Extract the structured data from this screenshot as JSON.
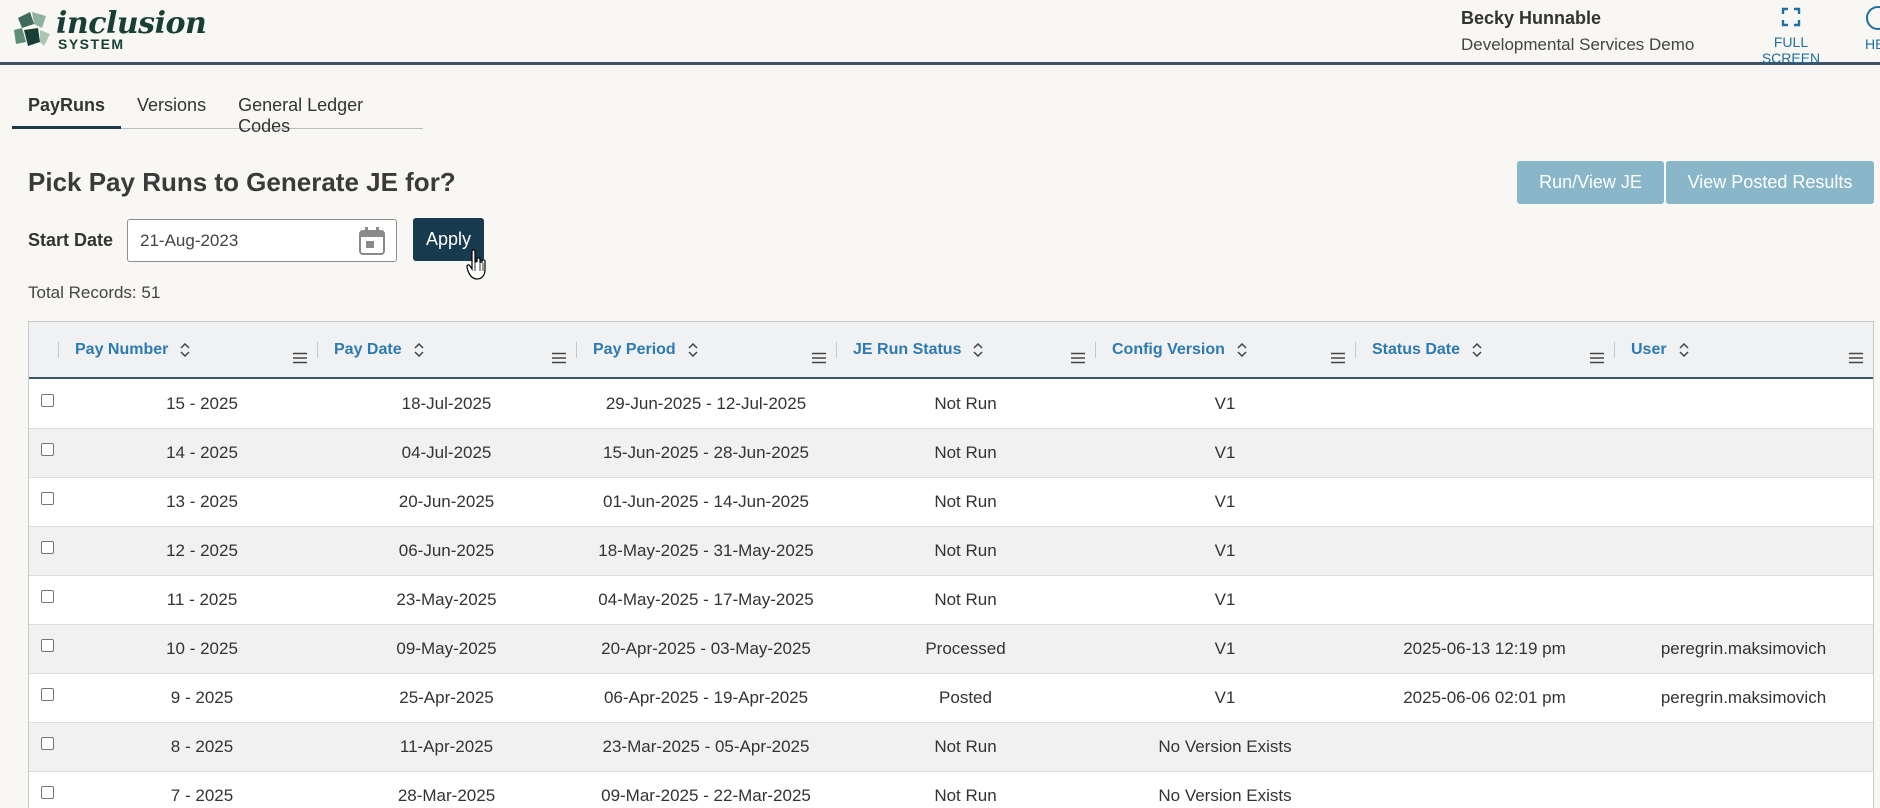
{
  "app": {
    "logo_main": "inclusion",
    "logo_sub": "SYSTEM",
    "user_name": "Becky Hunnable",
    "org_name": "Developmental Services Demo",
    "fullscreen_label": "FULL SCREEN",
    "help_label_cut": "HE"
  },
  "tabs": [
    {
      "label": "PayRuns",
      "active": true
    },
    {
      "label": "Versions",
      "active": false
    },
    {
      "label": "General Ledger Codes",
      "active": false
    }
  ],
  "page": {
    "title": "Pick Pay Runs to Generate JE for?",
    "run_view_label": "Run/View JE",
    "view_posted_label": "View Posted Results",
    "start_date_label": "Start Date",
    "start_date_value": "21-Aug-2023",
    "apply_label": "Apply",
    "total_records": "Total Records: 51"
  },
  "colors": {
    "primary_dark": "#173a4f",
    "button_disabled": "#8ab6c9",
    "header_link": "#2d7bb0"
  },
  "grid": {
    "columns": [
      "Pay Number",
      "Pay Date",
      "Pay Period",
      "JE Run Status",
      "Config Version",
      "Status Date",
      "User"
    ],
    "rows": [
      {
        "pay_number": "15 - 2025",
        "pay_date": "18-Jul-2025",
        "pay_period": "29-Jun-2025 - 12-Jul-2025",
        "status": "Not Run",
        "version": "V1",
        "status_date": "",
        "user": ""
      },
      {
        "pay_number": "14 - 2025",
        "pay_date": "04-Jul-2025",
        "pay_period": "15-Jun-2025 - 28-Jun-2025",
        "status": "Not Run",
        "version": "V1",
        "status_date": "",
        "user": ""
      },
      {
        "pay_number": "13 - 2025",
        "pay_date": "20-Jun-2025",
        "pay_period": "01-Jun-2025 - 14-Jun-2025",
        "status": "Not Run",
        "version": "V1",
        "status_date": "",
        "user": ""
      },
      {
        "pay_number": "12 - 2025",
        "pay_date": "06-Jun-2025",
        "pay_period": "18-May-2025 - 31-May-2025",
        "status": "Not Run",
        "version": "V1",
        "status_date": "",
        "user": ""
      },
      {
        "pay_number": "11 - 2025",
        "pay_date": "23-May-2025",
        "pay_period": "04-May-2025 - 17-May-2025",
        "status": "Not Run",
        "version": "V1",
        "status_date": "",
        "user": ""
      },
      {
        "pay_number": "10 - 2025",
        "pay_date": "09-May-2025",
        "pay_period": "20-Apr-2025 - 03-May-2025",
        "status": "Processed",
        "version": "V1",
        "status_date": "2025-06-13 12:19 pm",
        "user": "peregrin.maksimovich"
      },
      {
        "pay_number": "9 - 2025",
        "pay_date": "25-Apr-2025",
        "pay_period": "06-Apr-2025 - 19-Apr-2025",
        "status": "Posted",
        "version": "V1",
        "status_date": "2025-06-06 02:01 pm",
        "user": "peregrin.maksimovich"
      },
      {
        "pay_number": "8 - 2025",
        "pay_date": "11-Apr-2025",
        "pay_period": "23-Mar-2025 - 05-Apr-2025",
        "status": "Not Run",
        "version": "No Version Exists",
        "status_date": "",
        "user": ""
      },
      {
        "pay_number": "7 - 2025",
        "pay_date": "28-Mar-2025",
        "pay_period": "09-Mar-2025 - 22-Mar-2025",
        "status": "Not Run",
        "version": "No Version Exists",
        "status_date": "",
        "user": ""
      }
    ]
  }
}
